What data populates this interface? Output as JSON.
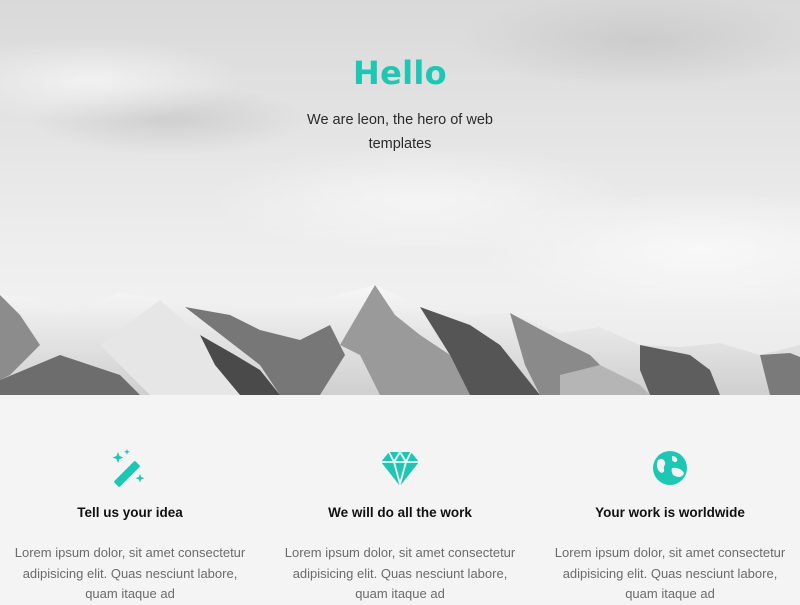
{
  "hero": {
    "title": "Hello",
    "subtitle": "We are leon, the hero of web templates"
  },
  "features": [
    {
      "icon": "magic-wand-icon",
      "title": "Tell us your idea",
      "text": "Lorem ipsum dolor, sit amet consectetur adipisicing elit. Quas nesciunt labore, quam itaque ad"
    },
    {
      "icon": "diamond-icon",
      "title": "We will do all the work",
      "text": "Lorem ipsum dolor, sit amet consectetur adipisicing elit. Quas nesciunt labore, quam itaque ad"
    },
    {
      "icon": "globe-icon",
      "title": "Your work is worldwide",
      "text": "Lorem ipsum dolor, sit amet consectetur adipisicing elit. Quas nesciunt labore, quam itaque ad"
    }
  ],
  "colors": {
    "accent": "#1ec7b4",
    "section_bg": "#f4f4f4",
    "heading": "#111111",
    "body_text": "#6b6b6b"
  }
}
